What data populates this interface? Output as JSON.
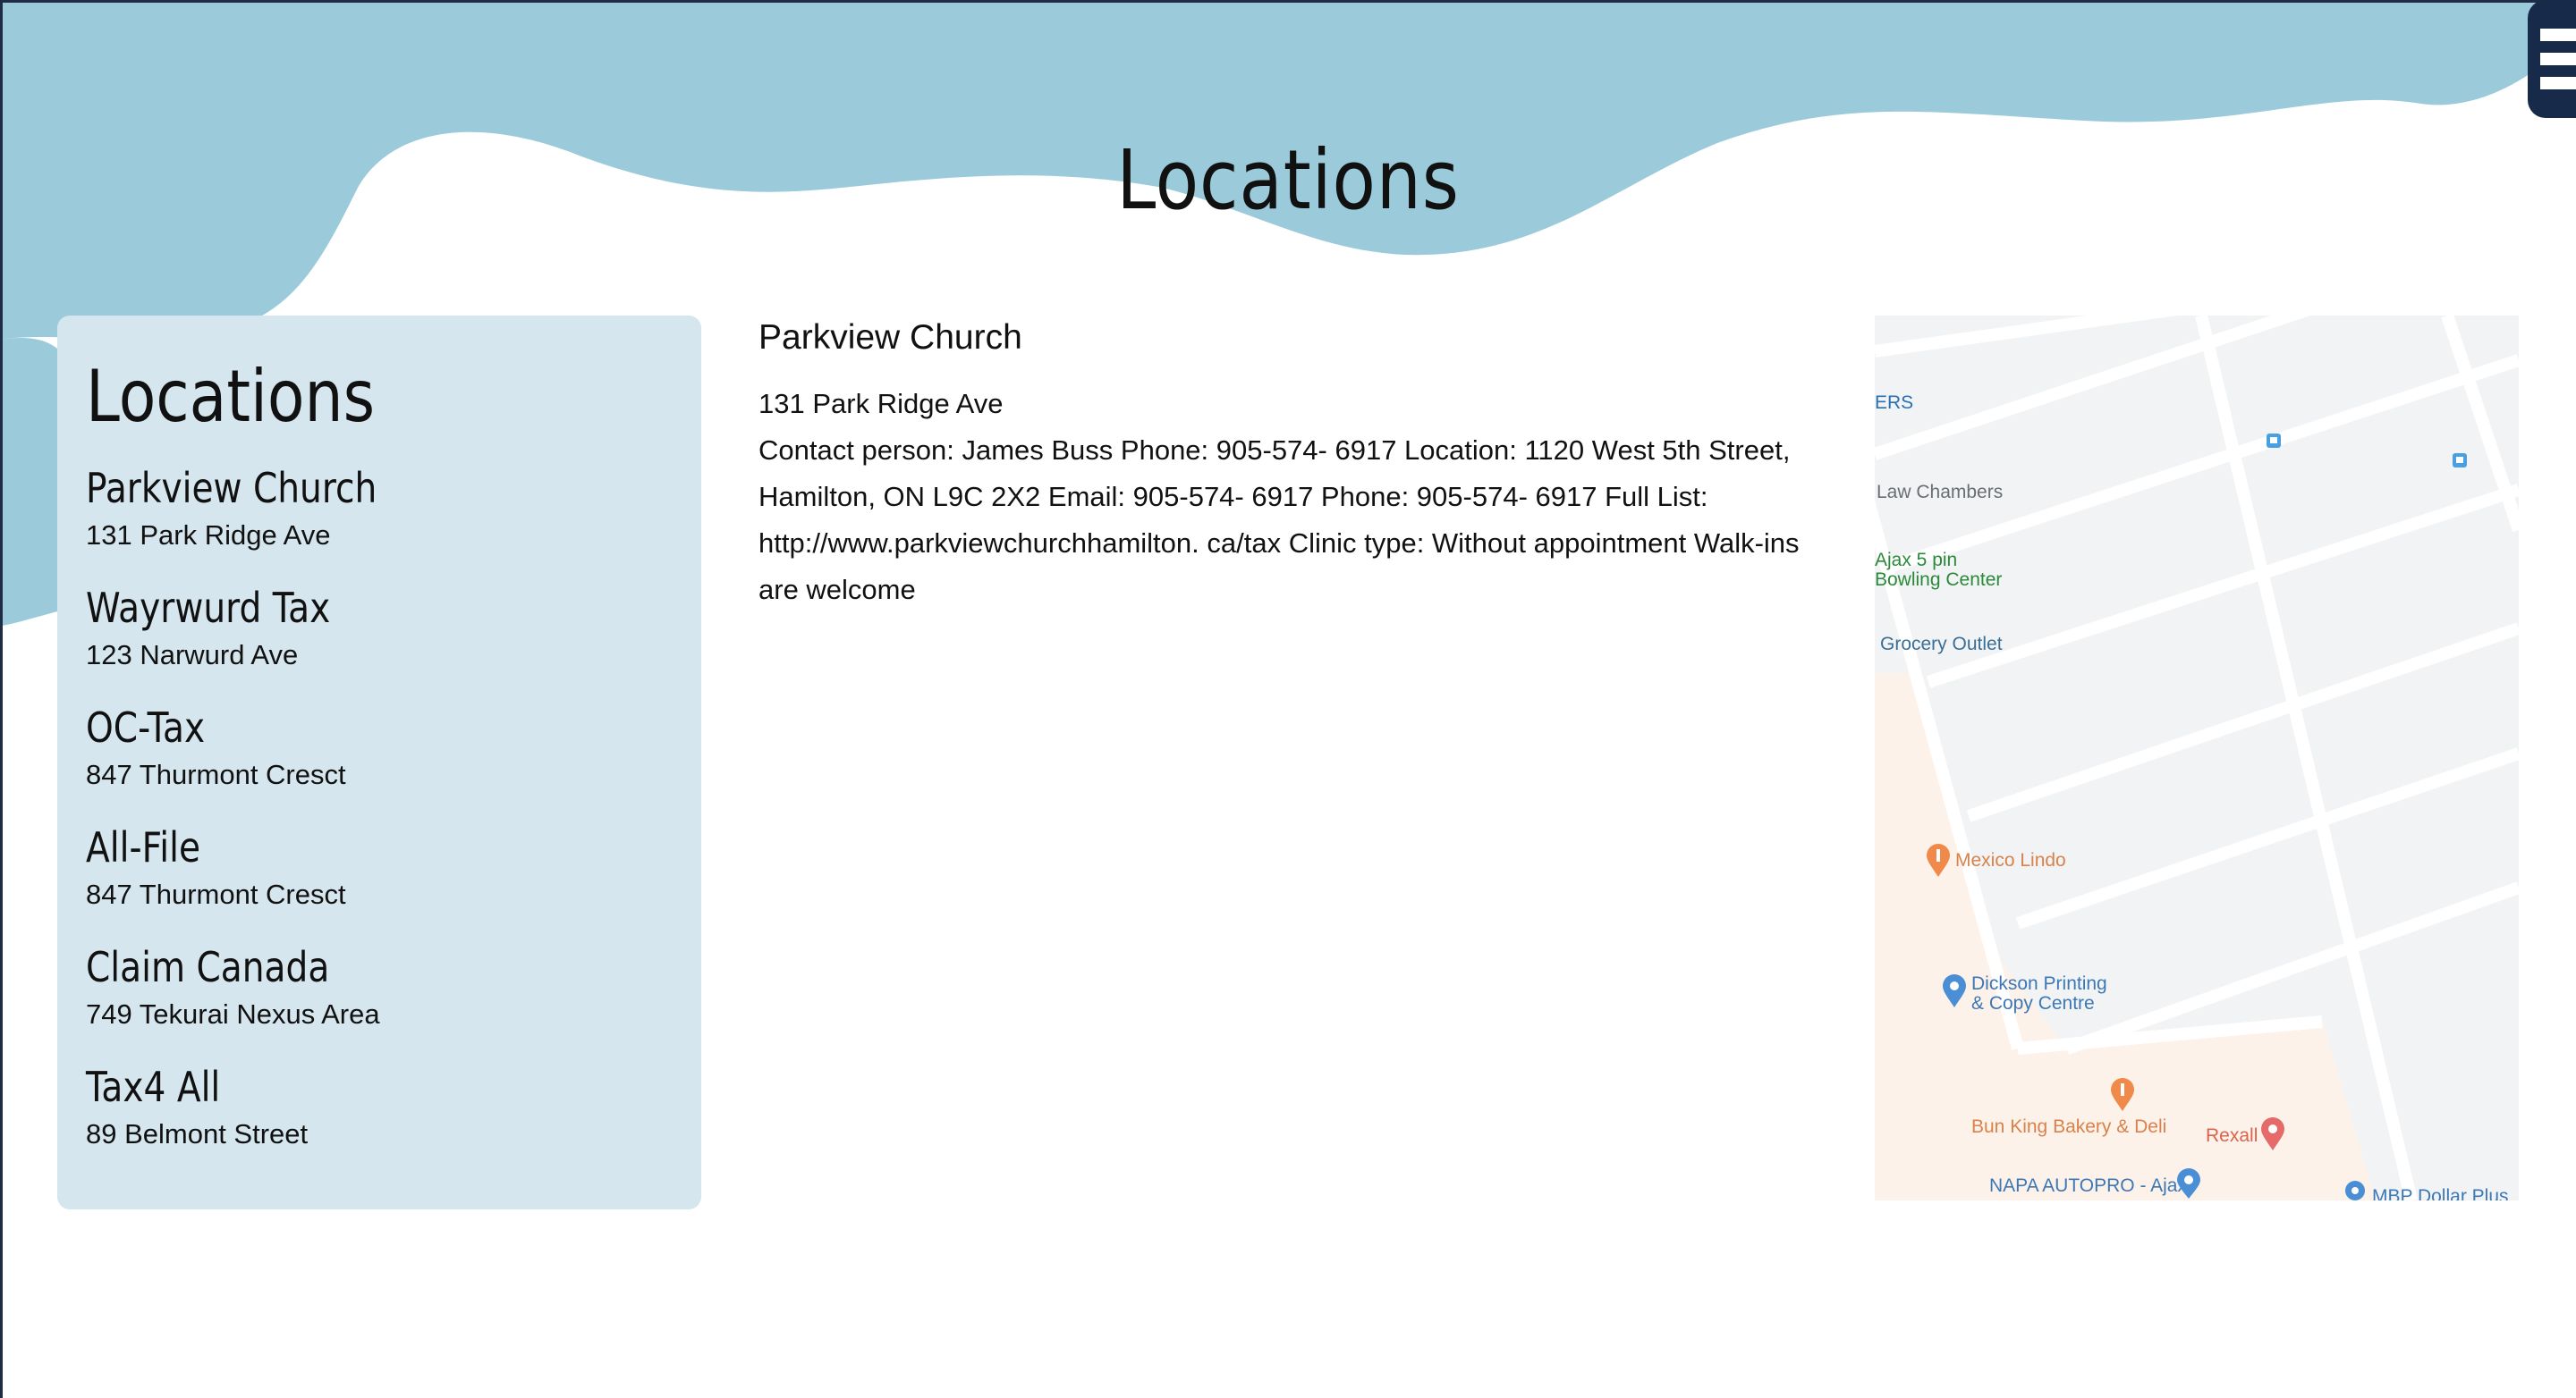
{
  "page": {
    "title": "Locations"
  },
  "colors": {
    "wave": "#9bcbdb",
    "sidebar_bg": "#d5e6ee",
    "menu": "#172a4a",
    "map_block": "#f1f3f4",
    "map_area": "#fdf2e9"
  },
  "menu": {
    "icon": "hamburger-menu-icon"
  },
  "sidebar": {
    "title": "Locations",
    "items": [
      {
        "name": "Parkview Church",
        "address": "131 Park Ridge Ave"
      },
      {
        "name": "Wayrwurd Tax",
        "address": "123 Narwurd Ave"
      },
      {
        "name": "OC-Tax",
        "address": "847 Thurmont Cresct"
      },
      {
        "name": "All-File",
        "address": "847 Thurmont Cresct"
      },
      {
        "name": "Claim Canada",
        "address": "749 Tekurai Nexus Area"
      },
      {
        "name": "Tax4 All",
        "address": "89 Belmont Street"
      }
    ]
  },
  "detail": {
    "name": "Parkview Church",
    "address": "131 Park Ridge Ave",
    "info": "Contact person: James Buss Phone: 905-574- 6917 Location: 1120 West 5th Street, Hamilton, ON L9C 2X2 Email: 905-574- 6917 Phone: 905-574- 6917 Full List: http://www.parkviewchurchhamilton. ca/tax Clinic type: Without appointment Walk-ins are welcome"
  },
  "map": {
    "labels": [
      "ERS",
      "Law Chambers",
      "Ajax 5 pin",
      "Bowling Center",
      "Grocery Outlet",
      "Mexico Lindo",
      "Dickson Printing",
      "& Copy Centre",
      "Bun King Bakery & Deli",
      "Rexall",
      "NAPA AUTOPRO - Ajax",
      "MBP Dollar Plus"
    ],
    "icons": [
      "transit-icon",
      "restaurant-pin-icon",
      "shopping-pin-icon",
      "pharmacy-pin-icon"
    ]
  }
}
